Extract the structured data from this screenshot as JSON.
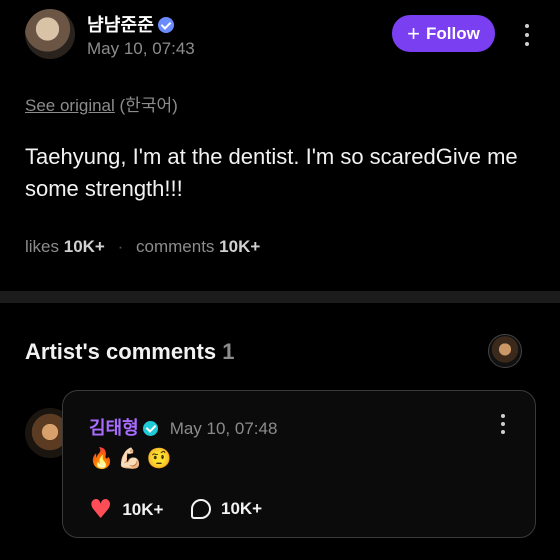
{
  "post": {
    "author": "냠냠준준",
    "time": "May 10, 07:43",
    "follow_label": "Follow",
    "see_original": "See original",
    "original_language": "(한국어)",
    "text": "Taehyung, I'm at the dentist. I'm so scaredGive me some strength!!!",
    "likes_label": "likes",
    "likes_count": "10K+",
    "comments_label": "comments",
    "comments_count": "10K+"
  },
  "artist_comments": {
    "title": "Artist's comments",
    "count": "1",
    "comment": {
      "author": "김태형",
      "time": "May 10, 07:48",
      "text": "🔥💪🏻🤨",
      "likes_count": "10K+",
      "replies_count": "10K+"
    }
  },
  "colors": {
    "accent": "#7b3ff2",
    "artist_name": "#a86cff",
    "heart": "#ff4d57",
    "verified": "#6a8cff",
    "verified_artist": "#1fc9d6"
  },
  "icons": {
    "verified": "verified-badge-icon",
    "plus": "plus-icon",
    "more": "more-vertical-icon",
    "heart": "heart-icon",
    "comment": "comment-bubble-icon"
  }
}
